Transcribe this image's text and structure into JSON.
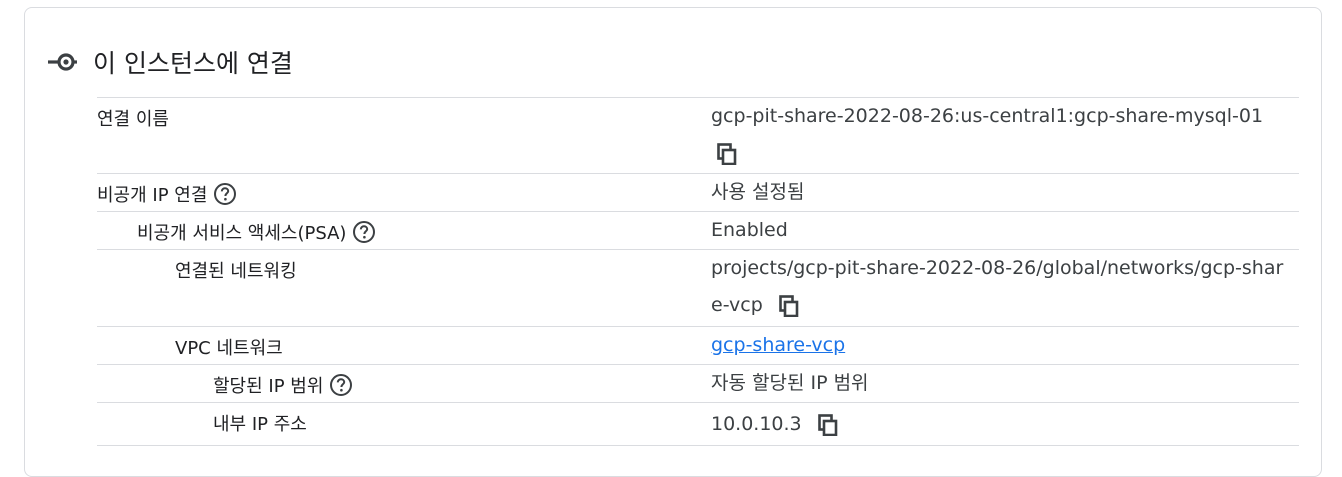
{
  "section": {
    "title": "이 인스턴스에 연결",
    "icon": "connect-icon"
  },
  "rows": [
    {
      "label": "연결 이름",
      "value": "gcp-pit-share-2022-08-26:us-central1:gcp-share-mysql-01",
      "copy": true,
      "help": false
    },
    {
      "label": "비공개 IP 연결",
      "value": "사용 설정됨",
      "copy": false,
      "help": true
    },
    {
      "label": "비공개 서비스 액세스(PSA)",
      "value": "Enabled",
      "copy": false,
      "help": true
    },
    {
      "label": "연결된 네트워킹",
      "value": "projects/gcp-pit-share-2022-08-26/global/networks/gcp-share-vcp",
      "copy": true,
      "help": false
    },
    {
      "label": "VPC 네트워크",
      "value": "gcp-share-vcp",
      "copy": false,
      "help": false,
      "link": true
    },
    {
      "label": "할당된 IP 범위",
      "value": "자동 할당된 IP 범위",
      "copy": false,
      "help": true
    },
    {
      "label": "내부 IP 주소",
      "value": "10.0.10.3",
      "copy": true,
      "help": false
    }
  ],
  "colors": {
    "link": "#1a73e8",
    "divider": "#dadce0",
    "text": "#202124",
    "value_text": "#3c4043"
  }
}
